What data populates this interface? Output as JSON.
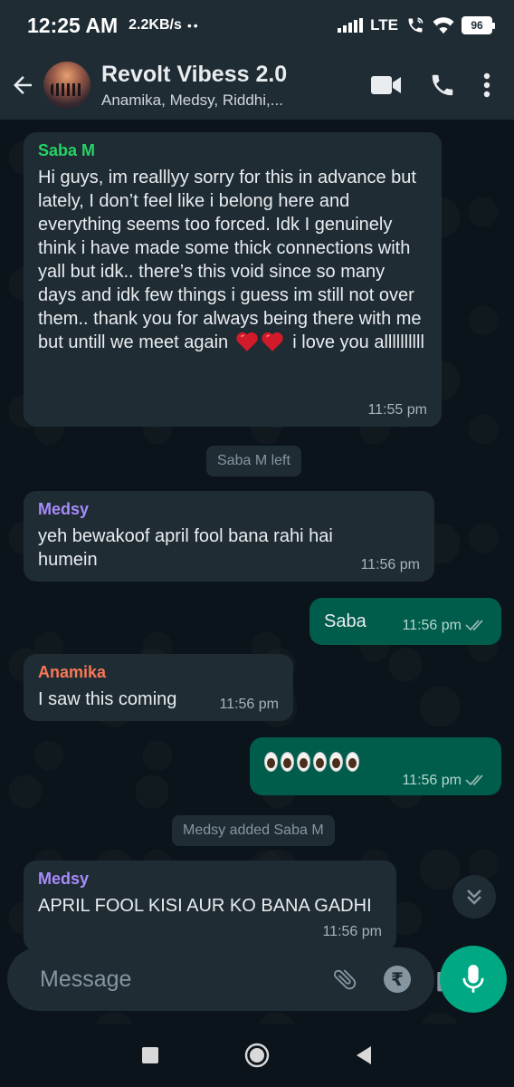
{
  "status_bar": {
    "time": "12:25 AM",
    "speed": "2.2KB/s",
    "dots": "••",
    "network": "LTE",
    "battery": "96"
  },
  "header": {
    "title": "Revolt Vibess 2.0",
    "members": "Anamika, Medsy, Riddhi,..."
  },
  "messages": [
    {
      "sender": "Saba M",
      "sender_color": "#25d366",
      "text": "Hi guys, im realllyy sorry for this in advance but lately, I don’t feel like i belong here and everything seems too forced. Idk I genuinely think i have made some thick connections with yall but idk.. there’s this void since so many days and idk few things i guess im still not over them.. thank you for always being there with me but untill we",
      "text_end_before": "meet again",
      "text_end_after": "i love you allllllllll",
      "time": "11:55 pm"
    },
    {
      "sender": "Medsy",
      "sender_color": "#a78bfa",
      "text": "yeh bewakoof april fool bana rahi hai humein",
      "time": "11:56 pm"
    },
    {
      "text": "Saba",
      "time": "11:56 pm"
    },
    {
      "sender": "Anamika",
      "sender_color": "#f97756",
      "text": "I saw this coming",
      "time": "11:56 pm"
    },
    {
      "time": "11:56 pm",
      "emoji_count": 6
    },
    {
      "sender": "Medsy",
      "sender_color": "#a78bfa",
      "text": "APRIL FOOL KISI AUR KO BANA GADHI",
      "time": "11:56 pm"
    }
  ],
  "system_messages": [
    "Saba M left",
    "Medsy added Saba M"
  ],
  "input": {
    "placeholder": "Message"
  },
  "colors": {
    "accent": "#00a884",
    "bubble_in": "#1f2c34",
    "bubble_out": "#005c4b",
    "ticks": "#8fb6ad"
  },
  "icons": [
    "back-arrow",
    "video-call",
    "phone",
    "more-vertical",
    "emoji",
    "attach",
    "rupee",
    "camera",
    "mic",
    "double-check",
    "chevron-down-double",
    "recents-square",
    "home-circle",
    "back-triangle"
  ]
}
